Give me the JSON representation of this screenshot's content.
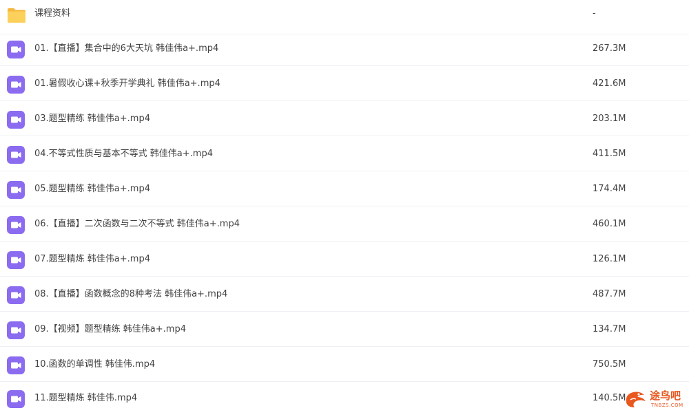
{
  "files": [
    {
      "name": "课程资料",
      "size": "-",
      "icon": "folder-icon"
    },
    {
      "name": "01.【直播】集合中的6大天坑 韩佳伟a+.mp4",
      "size": "267.3M",
      "icon": "video-file-icon"
    },
    {
      "name": "01.暑假收心课+秋季开学典礼 韩佳伟a+.mp4",
      "size": "421.6M",
      "icon": "video-file-icon"
    },
    {
      "name": "03.题型精练 韩佳伟a+.mp4",
      "size": "203.1M",
      "icon": "video-file-icon"
    },
    {
      "name": "04.不等式性质与基本不等式 韩佳伟a+.mp4",
      "size": "411.5M",
      "icon": "video-file-icon"
    },
    {
      "name": "05.题型精练 韩佳伟a+.mp4",
      "size": "174.4M",
      "icon": "video-file-icon"
    },
    {
      "name": "06.【直播】二次函数与二次不等式 韩佳伟a+.mp4",
      "size": "460.1M",
      "icon": "video-file-icon"
    },
    {
      "name": "07.题型精炼 韩佳伟a+.mp4",
      "size": "126.1M",
      "icon": "video-file-icon"
    },
    {
      "name": "08.【直播】函数概念的8种考法 韩佳伟a+.mp4",
      "size": "487.7M",
      "icon": "video-file-icon"
    },
    {
      "name": "09.【视频】题型精练 韩佳伟a+.mp4",
      "size": "134.7M",
      "icon": "video-file-icon"
    },
    {
      "name": "10.函数的单调性 韩佳伟.mp4",
      "size": "750.5M",
      "icon": "video-file-icon"
    },
    {
      "name": "11.题型精炼 韩佳伟.mp4",
      "size": "140.5M",
      "icon": "video-file-icon"
    }
  ],
  "watermark": {
    "text": "途鸟吧",
    "subtext": "TNBZS.COM"
  },
  "colors": {
    "folder": "#f7c948",
    "video": "#8b6cf0",
    "watermark": "#e8581f"
  }
}
